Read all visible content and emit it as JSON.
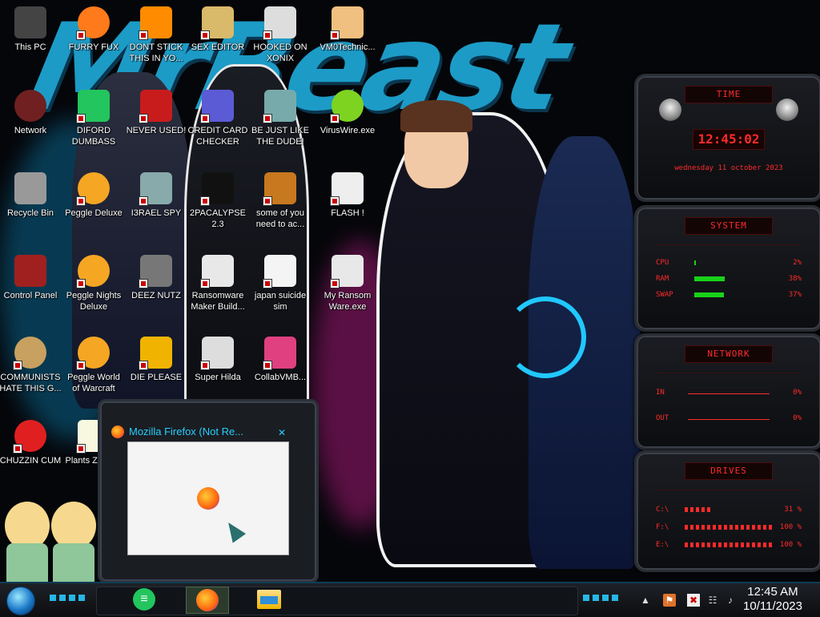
{
  "wallpaper": {
    "title": "MrBeast"
  },
  "desktop_icons": [
    {
      "label": "This PC",
      "icon": "computer-icon"
    },
    {
      "label": "FURRY FUX",
      "icon": "firefox-icon"
    },
    {
      "label": "DONT STICK THIS IN YO...",
      "icon": "vlc-icon"
    },
    {
      "label": "SEX EDITOR",
      "icon": "hxd-icon"
    },
    {
      "label": "HOOKED ON XONIX",
      "icon": "xonix-icon"
    },
    {
      "label": "VM0Technic...",
      "icon": "technician-icon"
    },
    {
      "label": "Network",
      "icon": "network-icon"
    },
    {
      "label": "DIFORD DUMBASS",
      "icon": "discord-icon"
    },
    {
      "label": "NEVER USED!",
      "icon": "devcpp-icon"
    },
    {
      "label": "CREDIT CARD CHECKER",
      "icon": "credit-card-icon"
    },
    {
      "label": "BE JUST LIKE THE DUDE!",
      "icon": "dude-icon"
    },
    {
      "label": "VirusWire.exe",
      "icon": "limewire-icon"
    },
    {
      "label": "Recycle Bin",
      "icon": "recycle-bin-icon"
    },
    {
      "label": "Peggle Deluxe",
      "icon": "peggle-icon"
    },
    {
      "label": "I3RAEL SPY",
      "icon": "spy-icon"
    },
    {
      "label": "2PACALYPSE 2.3",
      "icon": "terminal-icon"
    },
    {
      "label": "some of you need to ac...",
      "icon": "beaver-icon"
    },
    {
      "label": "FLASH !",
      "icon": "flash-icon"
    },
    {
      "label": "Control Panel",
      "icon": "control-panel-icon"
    },
    {
      "label": "Peggle Nights Deluxe",
      "icon": "peggle-nights-icon"
    },
    {
      "label": "DEEZ NUTZ",
      "icon": "stack-icon"
    },
    {
      "label": "Ransomware Maker Build...",
      "icon": "app-window-icon"
    },
    {
      "label": "japan suicide sim",
      "icon": "doc-icon"
    },
    {
      "label": "My Ransom Ware.exe",
      "icon": "app-window-icon"
    },
    {
      "label": "COMMUNISTS HATE THIS G...",
      "icon": "money-bag-icon"
    },
    {
      "label": "Peggle World of Warcraft",
      "icon": "peggle-wow-icon"
    },
    {
      "label": "DIE PLEASE",
      "icon": "de-icon"
    },
    {
      "label": "Super Hilda",
      "icon": "hilda-icon"
    },
    {
      "label": "CollabVMB...",
      "icon": "collabvm-icon"
    },
    {
      "label": "CHUZZIN CUM",
      "icon": "chuzzle-icon"
    },
    {
      "label": "Plants Zomb...",
      "icon": "plants-icon"
    }
  ],
  "gadgets": {
    "time": {
      "header": "TIME",
      "clock": "12:45:02",
      "date": "wednesday 11 october 2023"
    },
    "system": {
      "header": "SYSTEM",
      "rows": [
        {
          "name": "CPU",
          "value": "2%",
          "level": 0.02
        },
        {
          "name": "RAM",
          "value": "38%",
          "level": 0.38
        },
        {
          "name": "SWAP",
          "value": "37%",
          "level": 0.37
        }
      ]
    },
    "network": {
      "header": "NETWORK",
      "rows": [
        {
          "name": "IN",
          "value": "0%"
        },
        {
          "name": "OUT",
          "value": "0%"
        }
      ]
    },
    "drives": {
      "header": "DRIVES",
      "rows": [
        {
          "name": "C:\\",
          "value": "31 %",
          "level": 0.31
        },
        {
          "name": "F:\\",
          "value": "100 %",
          "level": 1.0
        },
        {
          "name": "E:\\",
          "value": "100 %",
          "level": 1.0
        }
      ]
    }
  },
  "preview": {
    "title": "Mozilla Firefox (Not Re..."
  },
  "taskbar": {
    "start_icon": "start-orb-icon",
    "pinned": [
      "discord-icon",
      "firefox-icon",
      "file-explorer-icon"
    ],
    "tray": [
      "flag-icon",
      "action-center-icon",
      "network-icon",
      "volume-icon"
    ],
    "time": "12:45 AM",
    "date": "10/11/2023"
  },
  "colors": {
    "accent_cyan": "#26d0ff",
    "gadget_red": "#ff2a2a",
    "wallpaper_blue": "#1fa8d6"
  }
}
